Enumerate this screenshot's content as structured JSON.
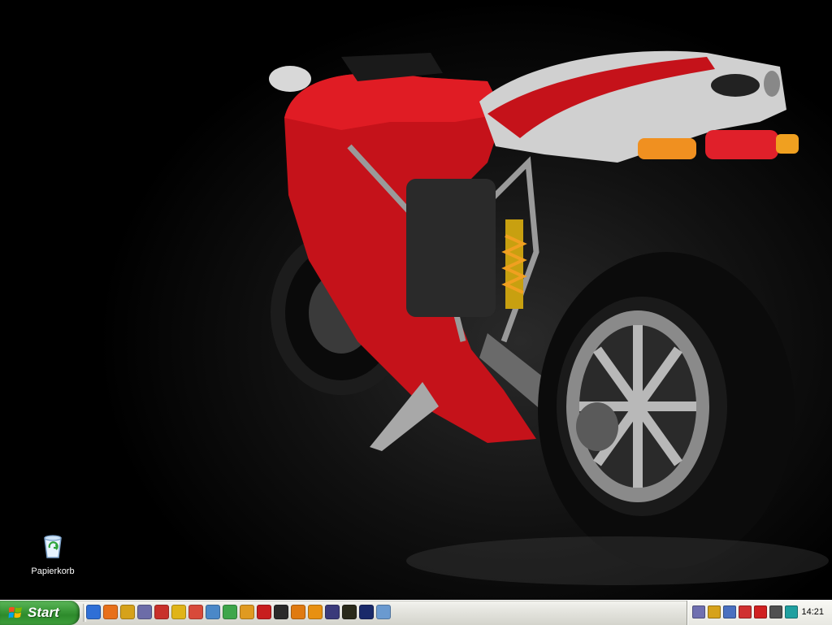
{
  "desktop": {
    "icons": [
      {
        "label": "Papierkorb",
        "icon": "recycle-bin-icon"
      }
    ]
  },
  "taskbar": {
    "start_label": "Start",
    "quick_launch": [
      {
        "icon": "internet-explorer-icon",
        "color": "#2f6fd6"
      },
      {
        "icon": "firefox-icon",
        "color": "#e8701a"
      },
      {
        "icon": "network-icon",
        "color": "#d6a21a"
      },
      {
        "icon": "headphones-icon",
        "color": "#6c6ca8"
      },
      {
        "icon": "chat-icon",
        "color": "#c8302a"
      },
      {
        "icon": "keys-icon",
        "color": "#e0b418"
      },
      {
        "icon": "media-icon",
        "color": "#d84a3a"
      },
      {
        "icon": "window-icon",
        "color": "#4a88c8"
      },
      {
        "icon": "music-icon",
        "color": "#3ea64a"
      },
      {
        "icon": "pencil-icon",
        "color": "#e09a20"
      },
      {
        "icon": "opera-icon",
        "color": "#c81e1e"
      },
      {
        "icon": "steam-icon",
        "color": "#2a2a2a"
      },
      {
        "icon": "half-life-icon",
        "color": "#e07a10"
      },
      {
        "icon": "half-life-2-icon",
        "color": "#e89010"
      },
      {
        "icon": "unreal-icon",
        "color": "#3a3a7a"
      },
      {
        "icon": "game-icon",
        "color": "#2a2a1a"
      },
      {
        "icon": "star-icon",
        "color": "#1a2a6a"
      },
      {
        "icon": "document-icon",
        "color": "#6a9ad0"
      }
    ],
    "tray": {
      "icons": [
        {
          "icon": "headphones-tray-icon",
          "color": "#7070b0"
        },
        {
          "icon": "network-tray-icon",
          "color": "#d6a21a"
        },
        {
          "icon": "display-tray-icon",
          "color": "#4a70c0"
        },
        {
          "icon": "network-disconnected-icon",
          "color": "#d03030"
        },
        {
          "icon": "antivirus-icon",
          "color": "#d02020"
        },
        {
          "icon": "volume-icon",
          "color": "#505050"
        },
        {
          "icon": "speaker-icon",
          "color": "#20a0a0"
        }
      ],
      "clock": "14:21"
    }
  }
}
